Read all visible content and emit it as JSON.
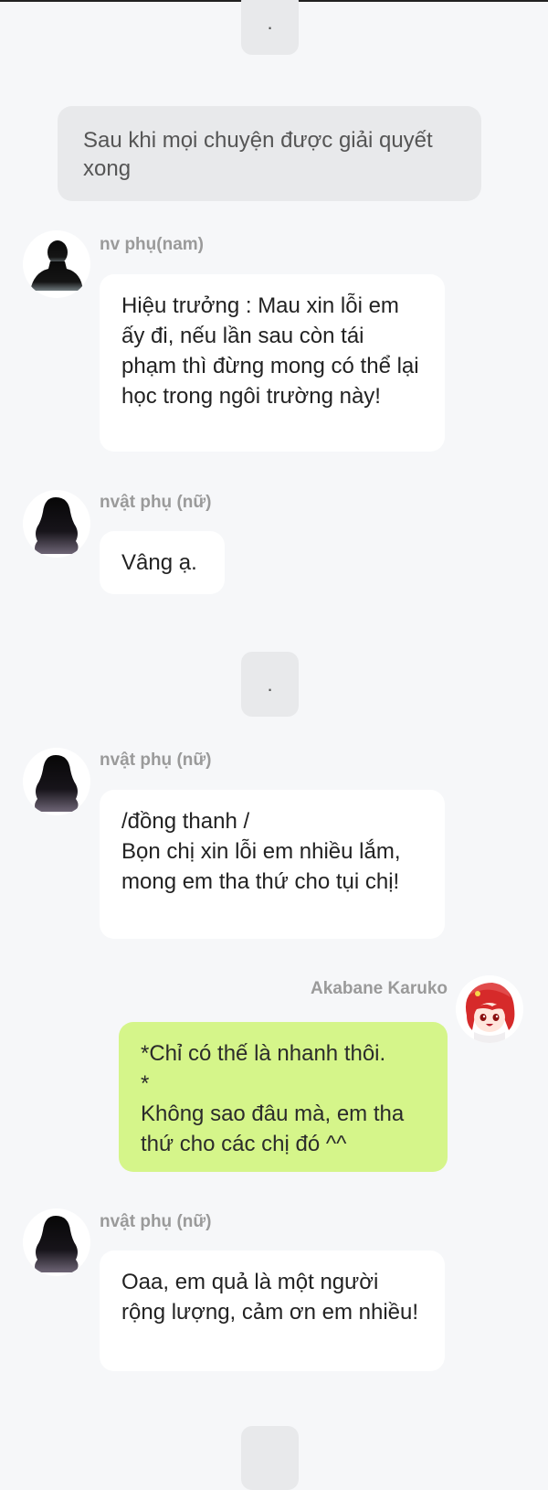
{
  "chat": {
    "dot": ".",
    "narration": "Sau khi mọi chuyện được giải quyết xong",
    "messages": [
      {
        "sender": "nv phụ(nam)",
        "text": "Hiệu trưởng : Mau xin lỗi em ấy đi, nếu lần sau còn tái phạm thì đừng mong có thể lại học trong ngôi trường này!"
      },
      {
        "sender": "nvật phụ (nữ)",
        "text": "Vâng ạ."
      },
      {
        "sender": "nvật phụ (nữ)",
        "text": "/đồng thanh /\nBọn chị xin lỗi em nhiều lắm, mong em tha thứ cho tụi chị!"
      },
      {
        "sender": "Akabane Karuko",
        "text": "*Chỉ có thế là nhanh thôi.\n*\nKhông sao đâu mà, em tha thứ cho các chị đó ^^"
      },
      {
        "sender": "nvật phụ (nữ)",
        "text": "Oaa, em quả là một người rộng lượng, cảm ơn em nhiều!"
      }
    ]
  },
  "colors": {
    "background": "#f6f7f9",
    "bubble": "#ffffff",
    "my_bubble": "#d5f58a",
    "narration_bubble": "#e8e9eb",
    "sender_name": "#9a9a9a"
  },
  "icons": {
    "male_avatar": "male-silhouette-avatar-icon",
    "female_avatar": "female-silhouette-avatar-icon",
    "my_avatar": "red-hair-anime-avatar-icon"
  }
}
